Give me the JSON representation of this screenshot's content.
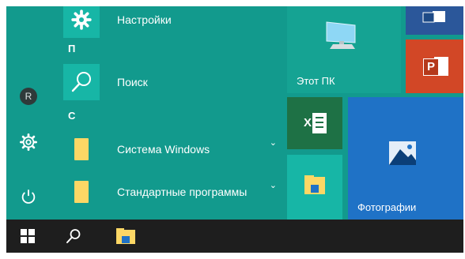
{
  "apps": {
    "settings_label": "Настройки",
    "group_p": "П",
    "search_label": "Поиск",
    "group_s": "С",
    "windows_system_label": "Система Windows",
    "accessories_label": "Стандартные программы"
  },
  "tiles": {
    "this_pc_label": "Этот ПК",
    "photos_label": "Фотографии",
    "excel_text": "X",
    "powerpoint_text": "P"
  },
  "rail": {
    "avatar_text": "R"
  },
  "icons": {
    "settings": "gear-icon",
    "search": "search-icon",
    "folder": "folder-icon",
    "start": "windows-logo-icon",
    "power": "power-icon",
    "user": "user-icon",
    "chevron": "chevron-down-icon"
  },
  "colors": {
    "start_background": "#129a8d",
    "app_tile": "#17b6a6",
    "excel": "#1e7145",
    "powerpoint": "#d24726",
    "word": "#2b579a",
    "photos": "#1f72c6",
    "taskbar": "#1e1e1e"
  }
}
